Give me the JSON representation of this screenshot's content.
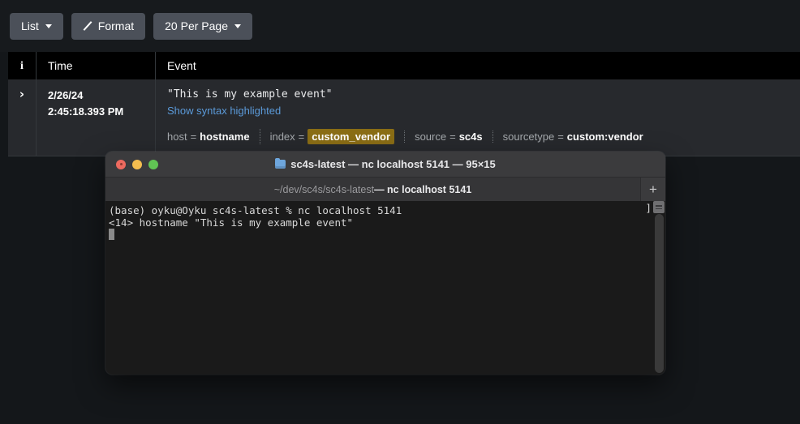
{
  "toolbar": {
    "list_label": "List",
    "format_label": "Format",
    "per_page_label": "20 Per Page"
  },
  "table": {
    "headers": {
      "info": "i",
      "time": "Time",
      "event": "Event"
    },
    "row": {
      "expand_icon": "›",
      "time_date": "2/26/24",
      "time_clock": "2:45:18.393 PM",
      "raw": "\"This is my example event\"",
      "syntax_link": "Show syntax highlighted",
      "fields": [
        {
          "key": "host",
          "eq": "=",
          "value": "hostname",
          "highlighted": false
        },
        {
          "key": "index",
          "eq": "=",
          "value": "custom_vendor",
          "highlighted": true
        },
        {
          "key": "source",
          "eq": "=",
          "value": "sc4s",
          "highlighted": false
        },
        {
          "key": "sourcetype",
          "eq": "=",
          "value": "custom:vendor",
          "highlighted": false
        }
      ]
    }
  },
  "terminal": {
    "title": "sc4s-latest — nc localhost 5141 — 95×15",
    "tab_path": "~/dev/sc4s/sc4s-latest ",
    "tab_cmd": "— nc localhost 5141",
    "new_tab_label": "+",
    "line1": "(base) oyku@Oyku sc4s-latest % nc localhost 5141",
    "line2": "<14> hostname \"This is my example event\"",
    "bracket": "]"
  },
  "colors": {
    "page_bg": "#14171a",
    "toolbar_bg": "#171a1d",
    "button_bg": "#4b5059",
    "row_bg": "#27292d",
    "header_bg": "#000000",
    "link": "#5b9ad9",
    "highlight": "#8a6d15",
    "terminal_bg": "#1a1a1a",
    "traffic_red": "#ed6a5f",
    "traffic_yellow": "#f4bd4f",
    "traffic_green": "#61c454"
  }
}
